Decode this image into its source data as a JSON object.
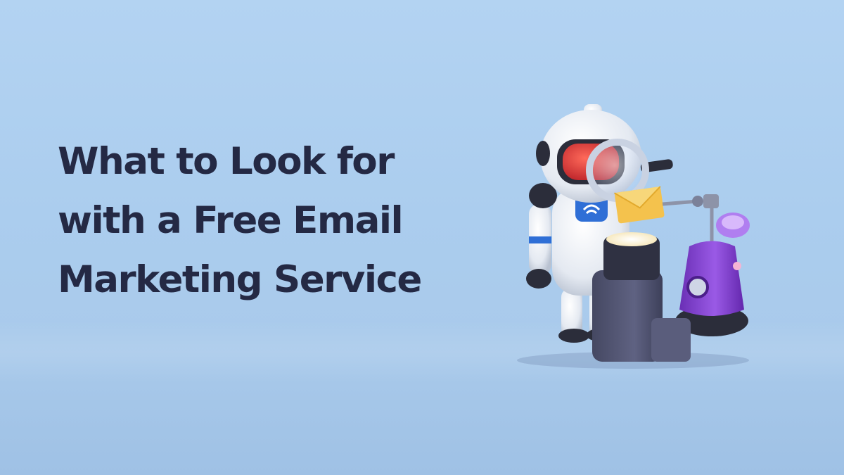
{
  "headline": {
    "lines": [
      "What to Look for",
      "with a Free Email",
      "Marketing Service"
    ],
    "color": "#242944"
  },
  "background": {
    "color_top": "#b3d3f2",
    "color_bottom": "#9fc1e5"
  },
  "illustration": {
    "subject": "robot with magnifying glass inspecting email envelope"
  }
}
